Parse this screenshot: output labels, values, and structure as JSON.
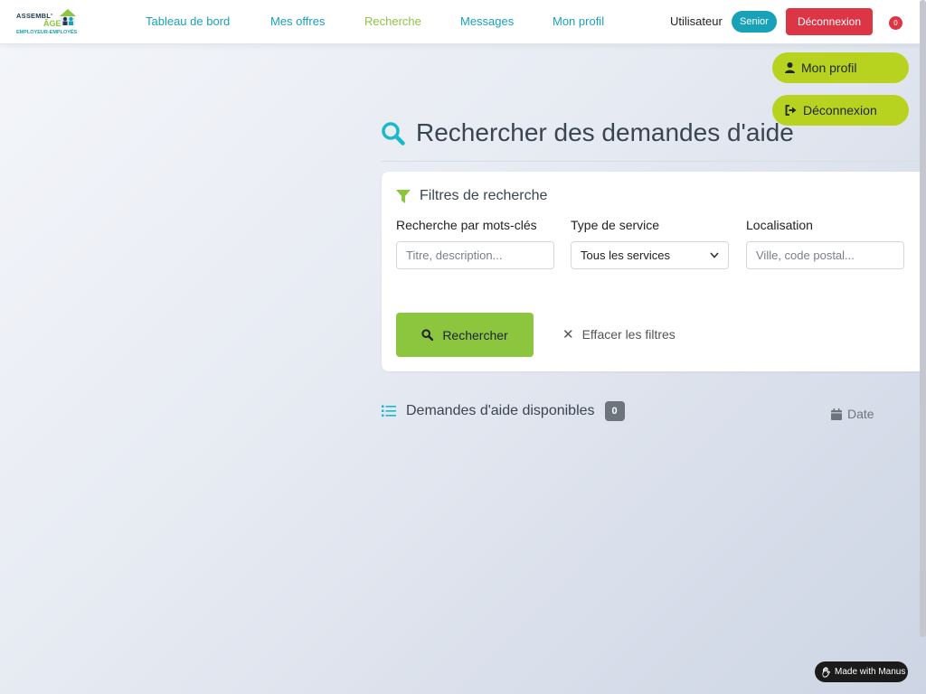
{
  "brand": {
    "line1": "ASSEMBL'",
    "line2": "ÂGE",
    "line3": "EMPLOYEUR-EMPLOYÉS"
  },
  "nav": {
    "items": [
      {
        "label": "Tableau de bord"
      },
      {
        "label": "Mes offres"
      },
      {
        "label": "Recherche",
        "active": true
      },
      {
        "label": "Messages"
      },
      {
        "label": "Mon profil"
      }
    ],
    "user_label": "Utilisateur",
    "role_badge": "Senior",
    "logout_label": "Déconnexion",
    "notification_count": "0"
  },
  "user_menu": {
    "profile_label": "Mon profil",
    "logout_label": "Déconnexion"
  },
  "page": {
    "title": "Rechercher des demandes d'aide"
  },
  "filters": {
    "title": "Filtres de recherche",
    "keywords": {
      "label": "Recherche par mots-clés",
      "placeholder": "Titre, description...",
      "value": ""
    },
    "service_type": {
      "label": "Type de service",
      "selected": "Tous les services"
    },
    "location": {
      "label": "Localisation",
      "placeholder": "Ville, code postal...",
      "value": ""
    },
    "search_button": "Rechercher",
    "clear_button": "Effacer les filtres"
  },
  "results": {
    "title": "Demandes d'aide disponibles",
    "count": "0",
    "sort_label": "Date"
  },
  "footer": {
    "made_with": "Made with Manus"
  },
  "colors": {
    "teal": "#17a2b8",
    "green": "#8cc63f",
    "lime": "#b8d31f",
    "danger": "#dc3545"
  },
  "icons": [
    "search-icon",
    "filter-icon",
    "user-icon",
    "sign-out-icon",
    "list-icon",
    "calendar-icon",
    "close-icon",
    "chevron-down-icon"
  ]
}
